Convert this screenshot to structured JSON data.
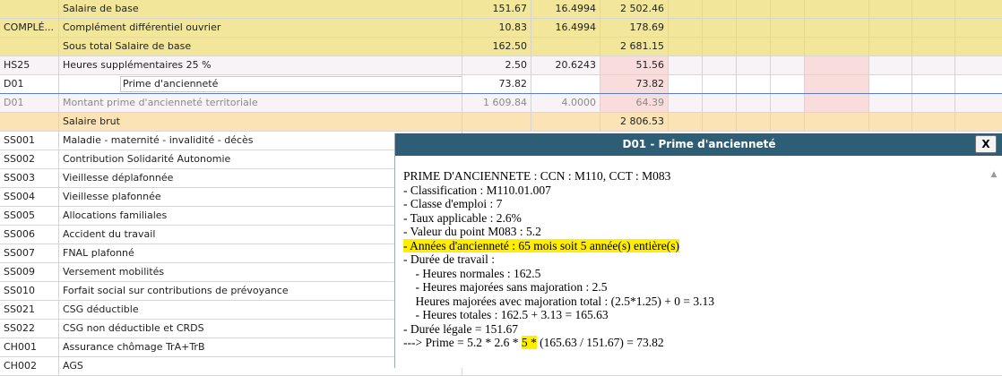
{
  "rows": [
    {
      "code": "",
      "label": "Salaire de base",
      "base": "151.67",
      "rate": "16.4994",
      "amount": "2 502.46"
    },
    {
      "code": "COMPLÉ...",
      "label": "Complément différentiel ouvrier",
      "base": "10.83",
      "rate": "16.4994",
      "amount": "178.69"
    },
    {
      "code": "",
      "label": "Sous total Salaire de base",
      "base": "162.50",
      "rate": "",
      "amount": "2 681.15"
    },
    {
      "code": "HS25",
      "label": "Heures supplémentaires 25 %",
      "base": "2.50",
      "rate": "20.6243",
      "amount": "51.56"
    },
    {
      "code": "D01",
      "label": "Prime d'ancienneté",
      "base": "73.82",
      "rate": "",
      "amount": "73.82"
    },
    {
      "code": "D01",
      "label": "Montant prime d'ancienneté territoriale",
      "base": "1 609.84",
      "rate": "4.0000",
      "amount": "64.39"
    },
    {
      "code": "",
      "label": "Salaire brut",
      "base": "",
      "rate": "",
      "amount": "2 806.53"
    },
    {
      "code": "SS001",
      "label": "Maladie - maternité - invalidité - décès"
    },
    {
      "code": "SS002",
      "label": "Contribution Solidarité Autonomie"
    },
    {
      "code": "SS003",
      "label": "Vieillesse déplafonnée"
    },
    {
      "code": "SS004",
      "label": "Vieillesse plafonnée"
    },
    {
      "code": "SS005",
      "label": "Allocations familiales"
    },
    {
      "code": "SS006",
      "label": "Accident du travail"
    },
    {
      "code": "SS007",
      "label": "FNAL plafonné"
    },
    {
      "code": "SS009",
      "label": "Versement mobilités"
    },
    {
      "code": "SS010",
      "label": "Forfait social sur contributions de prévoyance"
    },
    {
      "code": "SS021",
      "label": "CSG déductible"
    },
    {
      "code": "SS022",
      "label": "CSG non déductible et CRDS"
    },
    {
      "code": "CH001",
      "label": "Assurance chômage TrA+TrB"
    },
    {
      "code": "CH002",
      "label": "AGS"
    }
  ],
  "modal": {
    "title": "D01 - Prime d'ancienneté",
    "close_label": "X",
    "lines": [
      "PRIME D'ANCIENNETE : CCN : M110, CCT : M083",
      "- Classification : M110.01.007",
      "- Classe d'emploi : 7",
      "- Taux applicable : 2.6%",
      "- Valeur du point M083 : 5.2",
      "- Années d'ancienneté : 65 mois soit 5 année(s) entière(s)",
      "- Durée de travail :",
      "    - Heures normales : 162.5",
      "    - Heures majorées sans majoration : 2.5",
      "    Heures majorées avec majoration total : (2.5*1.25) + 0 = 3.13",
      "    - Heures totales : 162.5 + 3.13 = 165.63",
      "- Durée légale = 151.67"
    ],
    "prime_line": {
      "before": "---> Prime = 5.2 * 2.6 * ",
      "highlight": "5 *",
      "after": " (165.63 / 151.67) = 73.82"
    }
  }
}
